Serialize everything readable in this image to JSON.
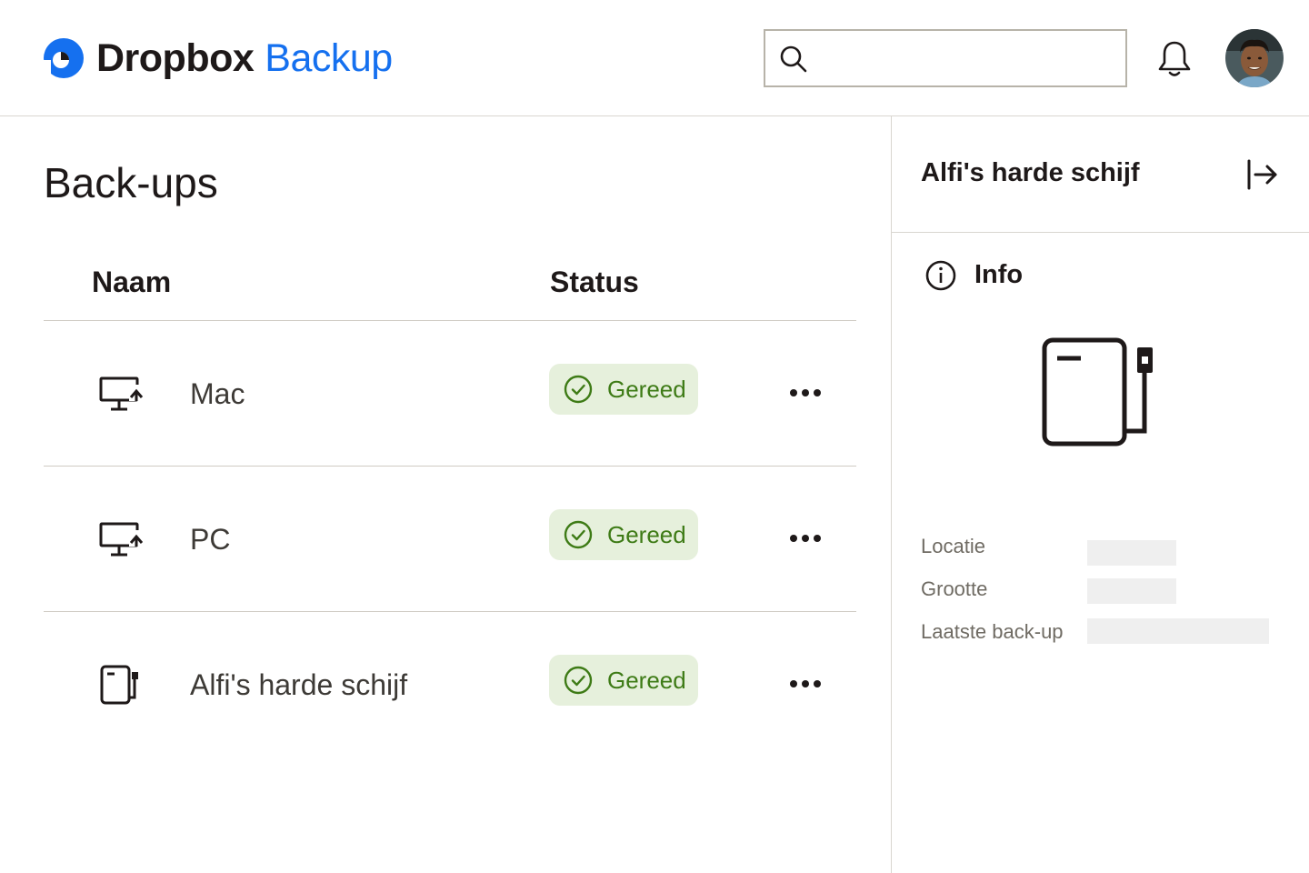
{
  "header": {
    "logo_brand": "Dropbox",
    "logo_product": "Backup",
    "search": {
      "value": "",
      "placeholder": ""
    },
    "icons": [
      "search-icon",
      "bell-icon",
      "avatar"
    ]
  },
  "main": {
    "title": "Back-ups",
    "columns": {
      "name": "Naam",
      "status": "Status"
    },
    "rows": [
      {
        "name": "Mac",
        "icon": "desktop-backup-icon",
        "status": "Gereed"
      },
      {
        "name": "PC",
        "icon": "desktop-backup-icon",
        "status": "Gereed"
      },
      {
        "name": "Alfi's harde schijf",
        "icon": "external-drive-icon",
        "status": "Gereed"
      }
    ]
  },
  "panel": {
    "title": "Alfi's harde schijf",
    "info_label": "Info",
    "meta": [
      {
        "label": "Locatie"
      },
      {
        "label": "Grootte"
      },
      {
        "label": "Laatste back-up"
      }
    ]
  },
  "colors": {
    "brand_blue": "#1570ef",
    "status_green_text": "#3e7b16",
    "status_green_bg": "#e6f0dc"
  }
}
